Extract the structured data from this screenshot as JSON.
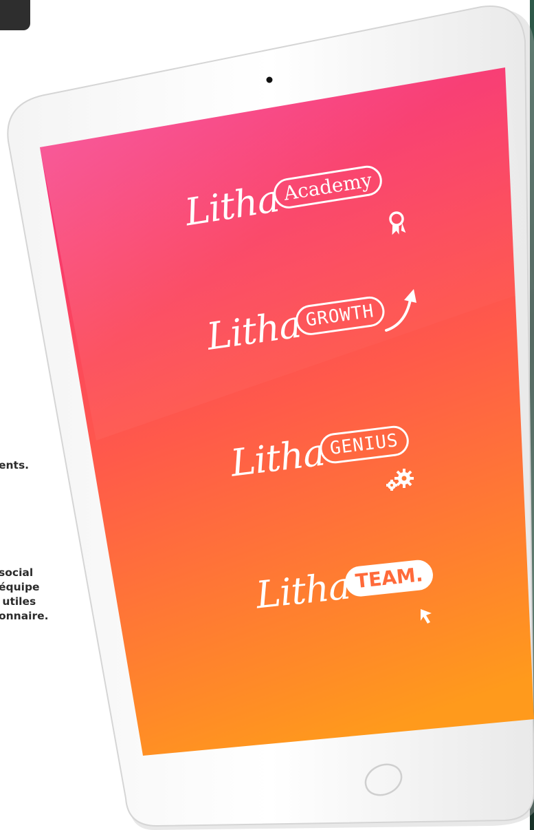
{
  "side_text": {
    "line1": "ents.",
    "paragraph": [
      "social",
      "équipe",
      "utiles",
      "onnaire."
    ]
  },
  "tablet": {
    "screen_gradient": [
      "#f5257e",
      "#ff5a4a",
      "#ff9a1c"
    ],
    "logos": [
      {
        "brand": "Litha",
        "label": "Academy",
        "icon": "award-ribbon-icon"
      },
      {
        "brand": "Litha",
        "label": "GROWTH",
        "icon": "arrow-up-icon"
      },
      {
        "brand": "Litha",
        "label": "GENIUS",
        "icon": "gears-icon"
      },
      {
        "brand": "Litha",
        "label": "TEAM.",
        "icon": "cursor-pointer-icon"
      }
    ]
  },
  "colors": {
    "bezel": "#ffffff",
    "bezel_shadow": "#d9d9d9",
    "text_dark": "#2b2b2b"
  }
}
